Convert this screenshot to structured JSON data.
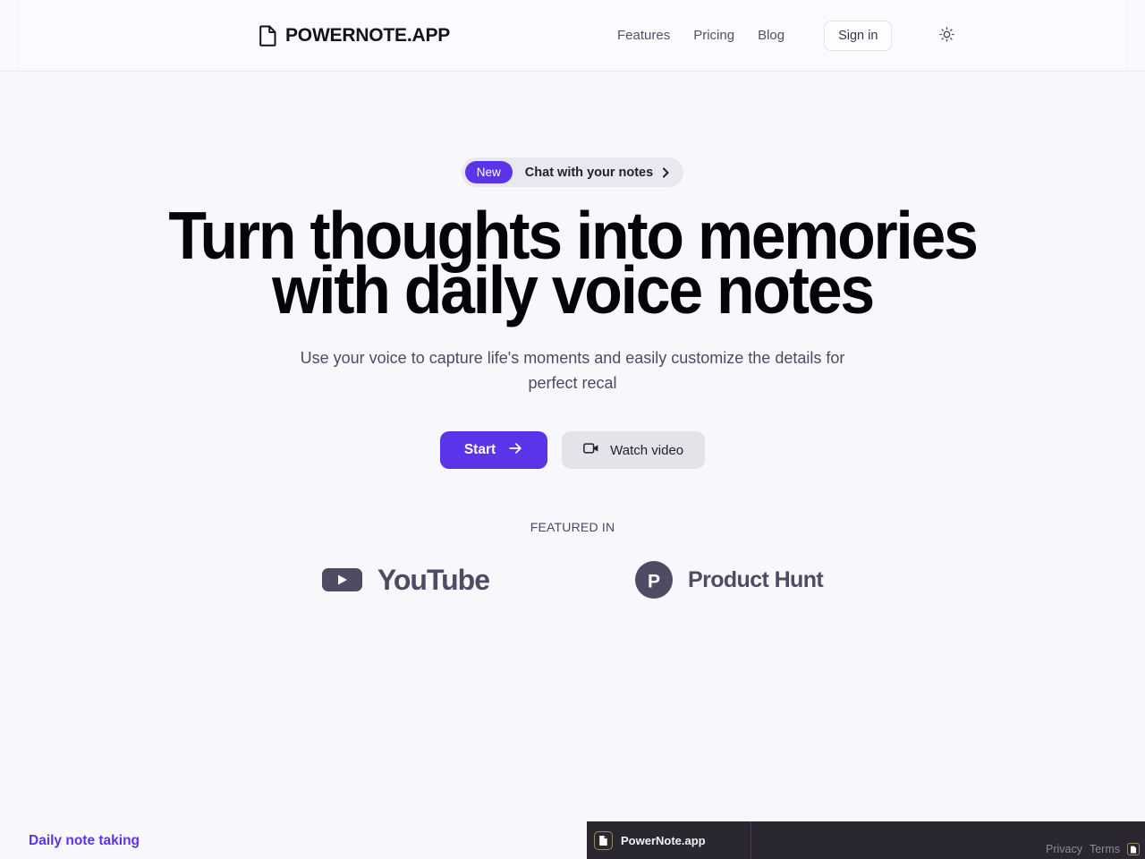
{
  "header": {
    "brand_icon": "document-icon",
    "brand_name": "POWERNOTE.APP",
    "nav": [
      {
        "label": "Features"
      },
      {
        "label": "Pricing"
      },
      {
        "label": "Blog"
      }
    ],
    "signin_label": "Sign in",
    "theme_icon": "sun-icon"
  },
  "hero": {
    "badge": {
      "new_label": "New",
      "text": "Chat with your notes",
      "chevron_icon": "chevron-right-icon"
    },
    "headline": "Turn thoughts into memories with daily voice notes",
    "subheadline": "Use your voice to capture life's moments and easily customize the details for perfect recal",
    "primary_cta": {
      "label": "Start",
      "icon": "arrow-right-icon"
    },
    "secondary_cta": {
      "label": "Watch video",
      "icon": "video-camera-icon"
    }
  },
  "featured": {
    "label": "FEATURED IN",
    "logos": [
      {
        "name": "YouTube",
        "icon": "youtube-icon"
      },
      {
        "name": "Product Hunt",
        "icon": "product-hunt-icon"
      }
    ]
  },
  "bottom": {
    "link_label": "Daily note taking"
  },
  "badge_bar": {
    "app_name": "PowerNote.app",
    "app_icon": "document-badge-icon",
    "privacy_label": "Privacy",
    "terms_label": "Terms",
    "mini_icon": "document-mini-icon"
  },
  "colors": {
    "accent_purple": "#5b33e8",
    "page_background": "#f8f7fc",
    "logo_slate": "#4f4b63",
    "dark_bar": "#2b2730",
    "dark_bar_gold": "#9a8654"
  }
}
